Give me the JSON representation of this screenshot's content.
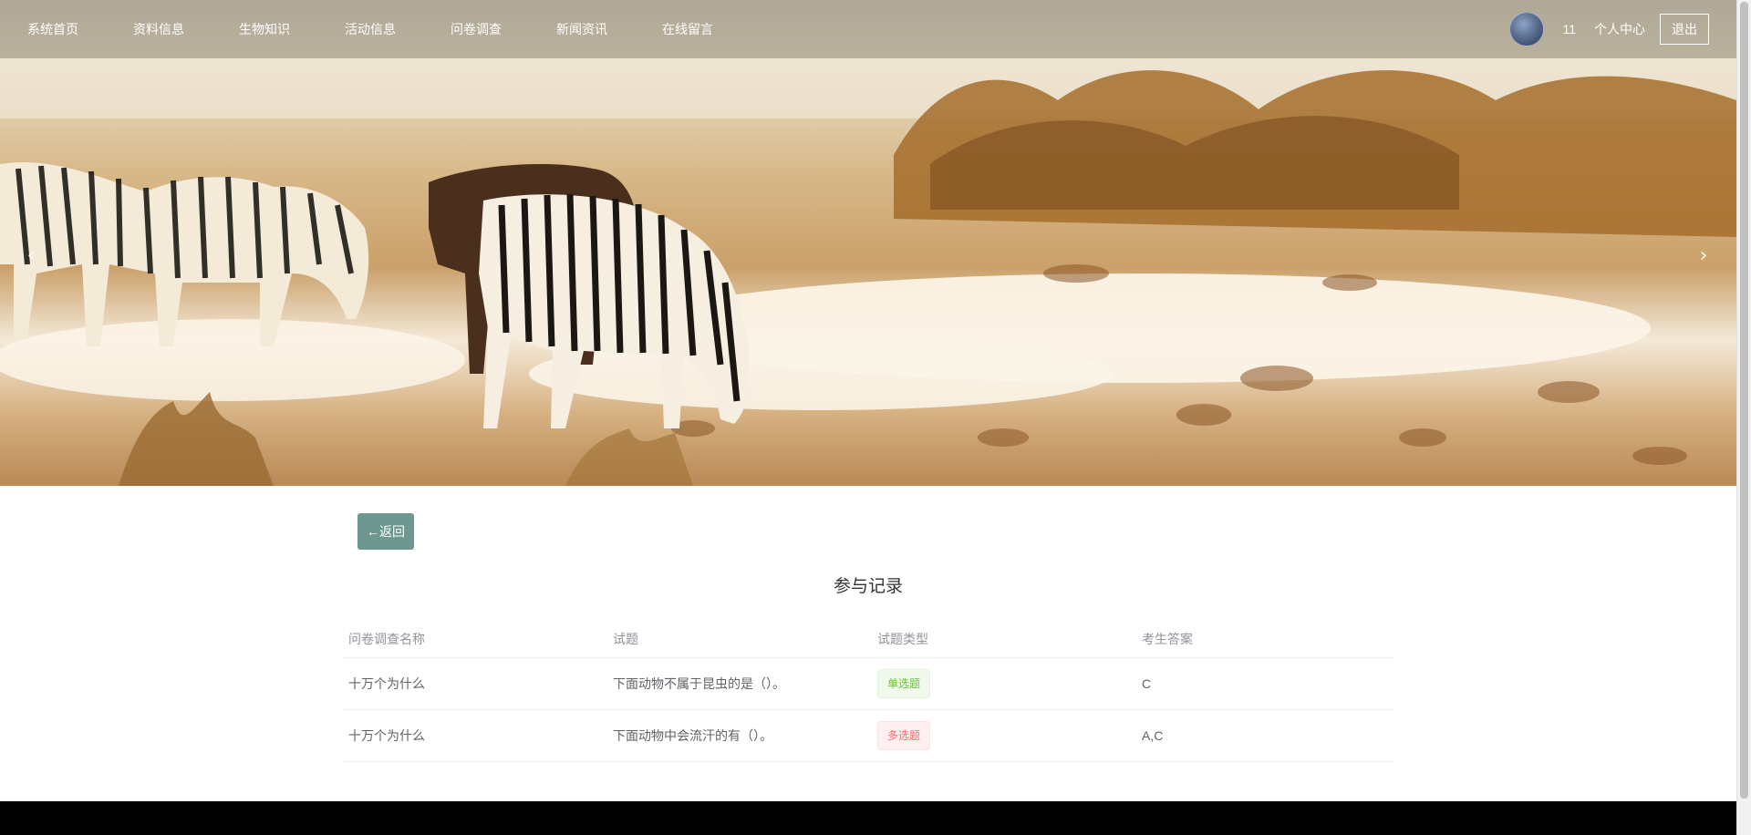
{
  "nav": {
    "items": [
      {
        "label": "系统首页"
      },
      {
        "label": "资料信息"
      },
      {
        "label": "生物知识"
      },
      {
        "label": "活动信息"
      },
      {
        "label": "问卷调查"
      },
      {
        "label": "新闻资讯"
      },
      {
        "label": "在线留言"
      }
    ],
    "username": "11",
    "personal_center": "个人中心",
    "logout": "退出"
  },
  "banner": {
    "image": "zebras-at-waterhole",
    "prev_icon": "‹",
    "next_icon": "›"
  },
  "content": {
    "back_label": "←返回",
    "title": "参与记录",
    "table": {
      "headers": [
        "问卷调查名称",
        "试题",
        "试题类型",
        "考生答案"
      ],
      "rows": [
        {
          "name": "十万个为什么",
          "question": "下面动物不属于昆虫的是（）。",
          "type": "单选题",
          "type_color": "#67c23a",
          "answer": "C"
        },
        {
          "name": "十万个为什么",
          "question": "下面动物中会流汗的有（）。",
          "type": "多选题",
          "type_color": "#f56c6c",
          "answer": "A,C"
        }
      ]
    }
  },
  "colors": {
    "back_button": "#6e9790",
    "footer": "#000000"
  }
}
